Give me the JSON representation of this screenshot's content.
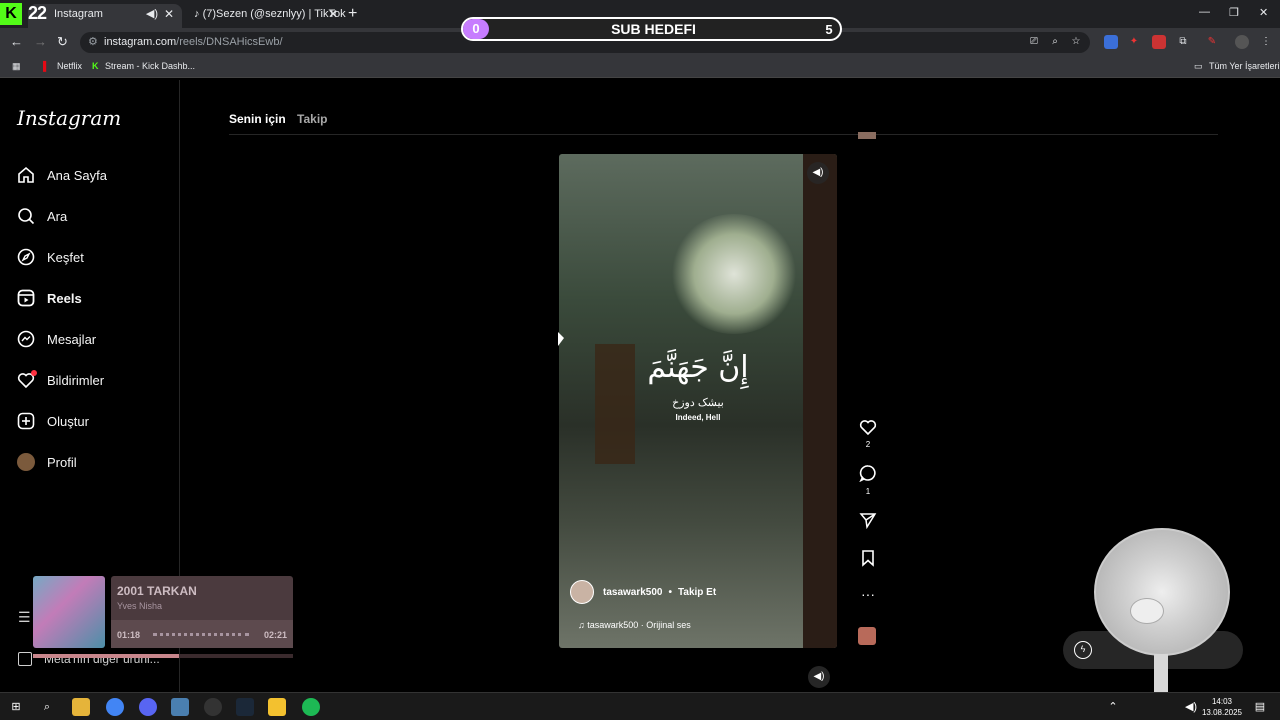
{
  "browser": {
    "active_tab_title": "Instagram",
    "active_tab_badge": "22",
    "inactive_tab_title": "(7)Sezen (@seznlyy) | TikTok",
    "url_host": "instagram.com",
    "url_path": "/reels/DNSAHicsEwb/",
    "bookmarks": [
      "Netflix",
      "Stream - Kick Dashb...",
      "Tüm Yer İşaretleri"
    ]
  },
  "overlay": {
    "subgoal_title": "SUB HEDEFI",
    "subgoal_current": "0",
    "subgoal_target": "5"
  },
  "instagram": {
    "logo": "Instagram",
    "nav": [
      {
        "label": "Ana Sayfa",
        "icon": "home-icon"
      },
      {
        "label": "Ara",
        "icon": "search-icon"
      },
      {
        "label": "Keşfet",
        "icon": "compass-icon"
      },
      {
        "label": "Reels",
        "icon": "reels-icon"
      },
      {
        "label": "Mesajlar",
        "icon": "messenger-icon"
      },
      {
        "label": "Bildirimler",
        "icon": "heart-icon"
      },
      {
        "label": "Oluştur",
        "icon": "plus-square-icon"
      },
      {
        "label": "Profil",
        "icon": "avatar"
      }
    ],
    "meta_more": "Meta'nın diğer ürünl...",
    "feed_tabs": [
      "Senin için",
      "Takip"
    ],
    "reel": {
      "arabic_text": "إِنَّ جَهَنَّمَ",
      "urdu_text": "بیشک دوزخ",
      "english_text": "Indeed, Hell",
      "username": "tasawark500",
      "follow_label": "Takip Et",
      "audio": "tasawark500 · Orijinal ses"
    },
    "actions": {
      "likes": "2",
      "comments": "1"
    }
  },
  "music_player": {
    "track": "2001 TARKAN",
    "artist": "Yves Nisha",
    "elapsed": "01:18",
    "total": "02:21",
    "progress": 0.56
  },
  "taskbar": {
    "time": "14:03",
    "date": "13.08.2025"
  }
}
